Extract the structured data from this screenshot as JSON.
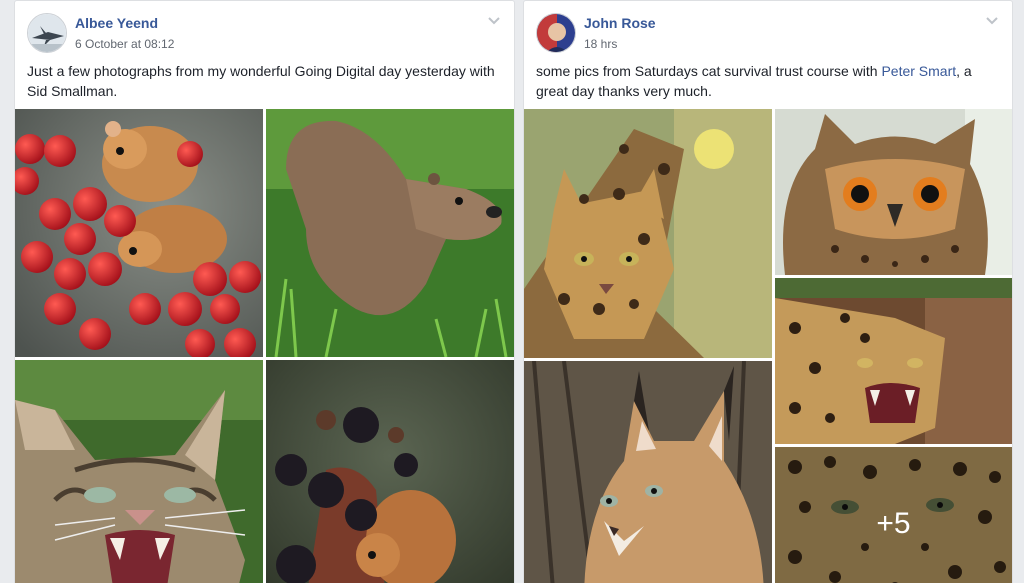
{
  "posts": [
    {
      "author": "Albee Yeend",
      "time": "6 October at 08:12",
      "text": "Just a few photographs from my wonderful Going Digital day yesterday with Sid Smallman.",
      "photos": [
        {
          "icon": "harvest-mice-on-berries-photo"
        },
        {
          "icon": "otter-photo"
        },
        {
          "icon": "wildcat-snarling-photo"
        },
        {
          "icon": "mouse-on-blackberries-photo"
        }
      ]
    },
    {
      "author": "John Rose",
      "time": "18 hrs",
      "text_before": "some pics from Saturdays cat survival trust course with ",
      "mention": "Peter Smart",
      "text_after": ", a great day thanks very much.",
      "photos": [
        {
          "icon": "leopard-cat-photo"
        },
        {
          "icon": "eagle-owl-photo"
        },
        {
          "icon": "leopard-roaring-photo"
        },
        {
          "icon": "caracal-photo"
        },
        {
          "icon": "leopard-closeup-photo"
        }
      ],
      "more_count": "+5"
    }
  ]
}
